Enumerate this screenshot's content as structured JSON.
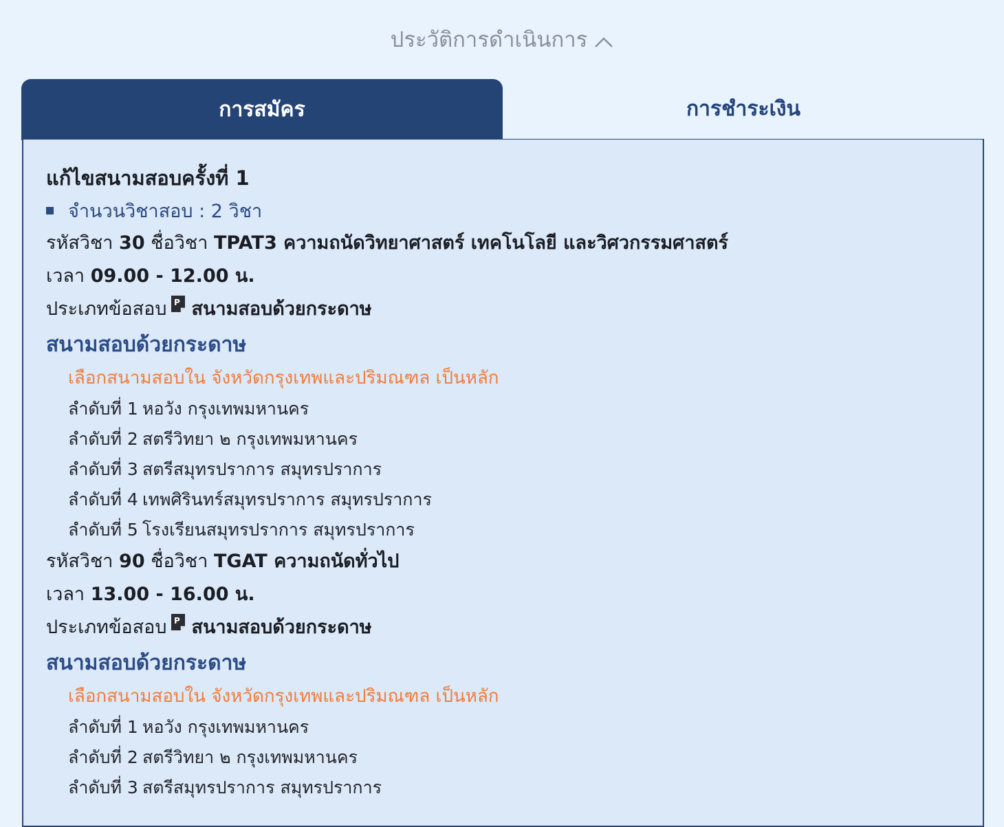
{
  "header": {
    "history_label": "ประวัติการดำเนินการ"
  },
  "tabs": [
    {
      "label": "การสมัคร",
      "active": true
    },
    {
      "label": "การชำระเงิน",
      "active": false
    }
  ],
  "panel": {
    "title": "แก้ไขสนามสอบครั้งที่ 1",
    "subject_count": "จำนวนวิชาสอบ : 2 วิชา",
    "subjects": [
      {
        "code_prefix": "รหัสวิชา",
        "code": "30",
        "name_prefix": "ชื่อวิชา",
        "name": "TPAT3 ความถนัดวิทยาศาสตร์ เทคโนโลยี และวิศวกรรมศาสตร์",
        "time_prefix": "เวลา",
        "time": "09.00 - 12.00 น.",
        "type_prefix": "ประเภทข้อสอบ",
        "type": "สนามสอบด้วยกระดาษ",
        "centers_heading": "สนามสอบด้วยกระดาษ",
        "choose_note": "เลือกสนามสอบใน จังหวัดกรุงเทพและปริมณฑล เป็นหลัก",
        "ranks": [
          {
            "label": "ลำดับที่ 1",
            "value": "หอวัง กรุงเทพมหานคร"
          },
          {
            "label": "ลำดับที่ 2",
            "value": "สตรีวิทยา ๒ กรุงเทพมหานคร"
          },
          {
            "label": "ลำดับที่ 3",
            "value": "สตรีสมุทรปราการ สมุทรปราการ"
          },
          {
            "label": "ลำดับที่ 4",
            "value": "เทพศิรินทร์สมุทรปราการ สมุทรปราการ"
          },
          {
            "label": "ลำดับที่ 5",
            "value": "โรงเรียนสมุทรปราการ สมุทรปราการ"
          }
        ]
      },
      {
        "code_prefix": "รหัสวิชา",
        "code": "90",
        "name_prefix": "ชื่อวิชา",
        "name": "TGAT ความถนัดทั่วไป",
        "time_prefix": "เวลา",
        "time": "13.00 - 16.00 น.",
        "type_prefix": "ประเภทข้อสอบ",
        "type": "สนามสอบด้วยกระดาษ",
        "centers_heading": "สนามสอบด้วยกระดาษ",
        "choose_note": "เลือกสนามสอบใน จังหวัดกรุงเทพและปริมณฑล เป็นหลัก",
        "ranks": [
          {
            "label": "ลำดับที่ 1",
            "value": "หอวัง กรุงเทพมหานคร"
          },
          {
            "label": "ลำดับที่ 2",
            "value": "สตรีวิทยา ๒ กรุงเทพมหานคร"
          },
          {
            "label": "ลำดับที่ 3",
            "value": "สตรีสมุทรปราการ สมุทรปราการ"
          }
        ]
      }
    ]
  },
  "icons": {
    "paper_exam_icon_letter": "P"
  },
  "colors": {
    "page_bg": "#e9f3fd",
    "panel_bg": "#dce9f8",
    "accent_navy": "#254476",
    "heading_blue": "#2a4b86",
    "note_orange": "#ef7d3c"
  }
}
